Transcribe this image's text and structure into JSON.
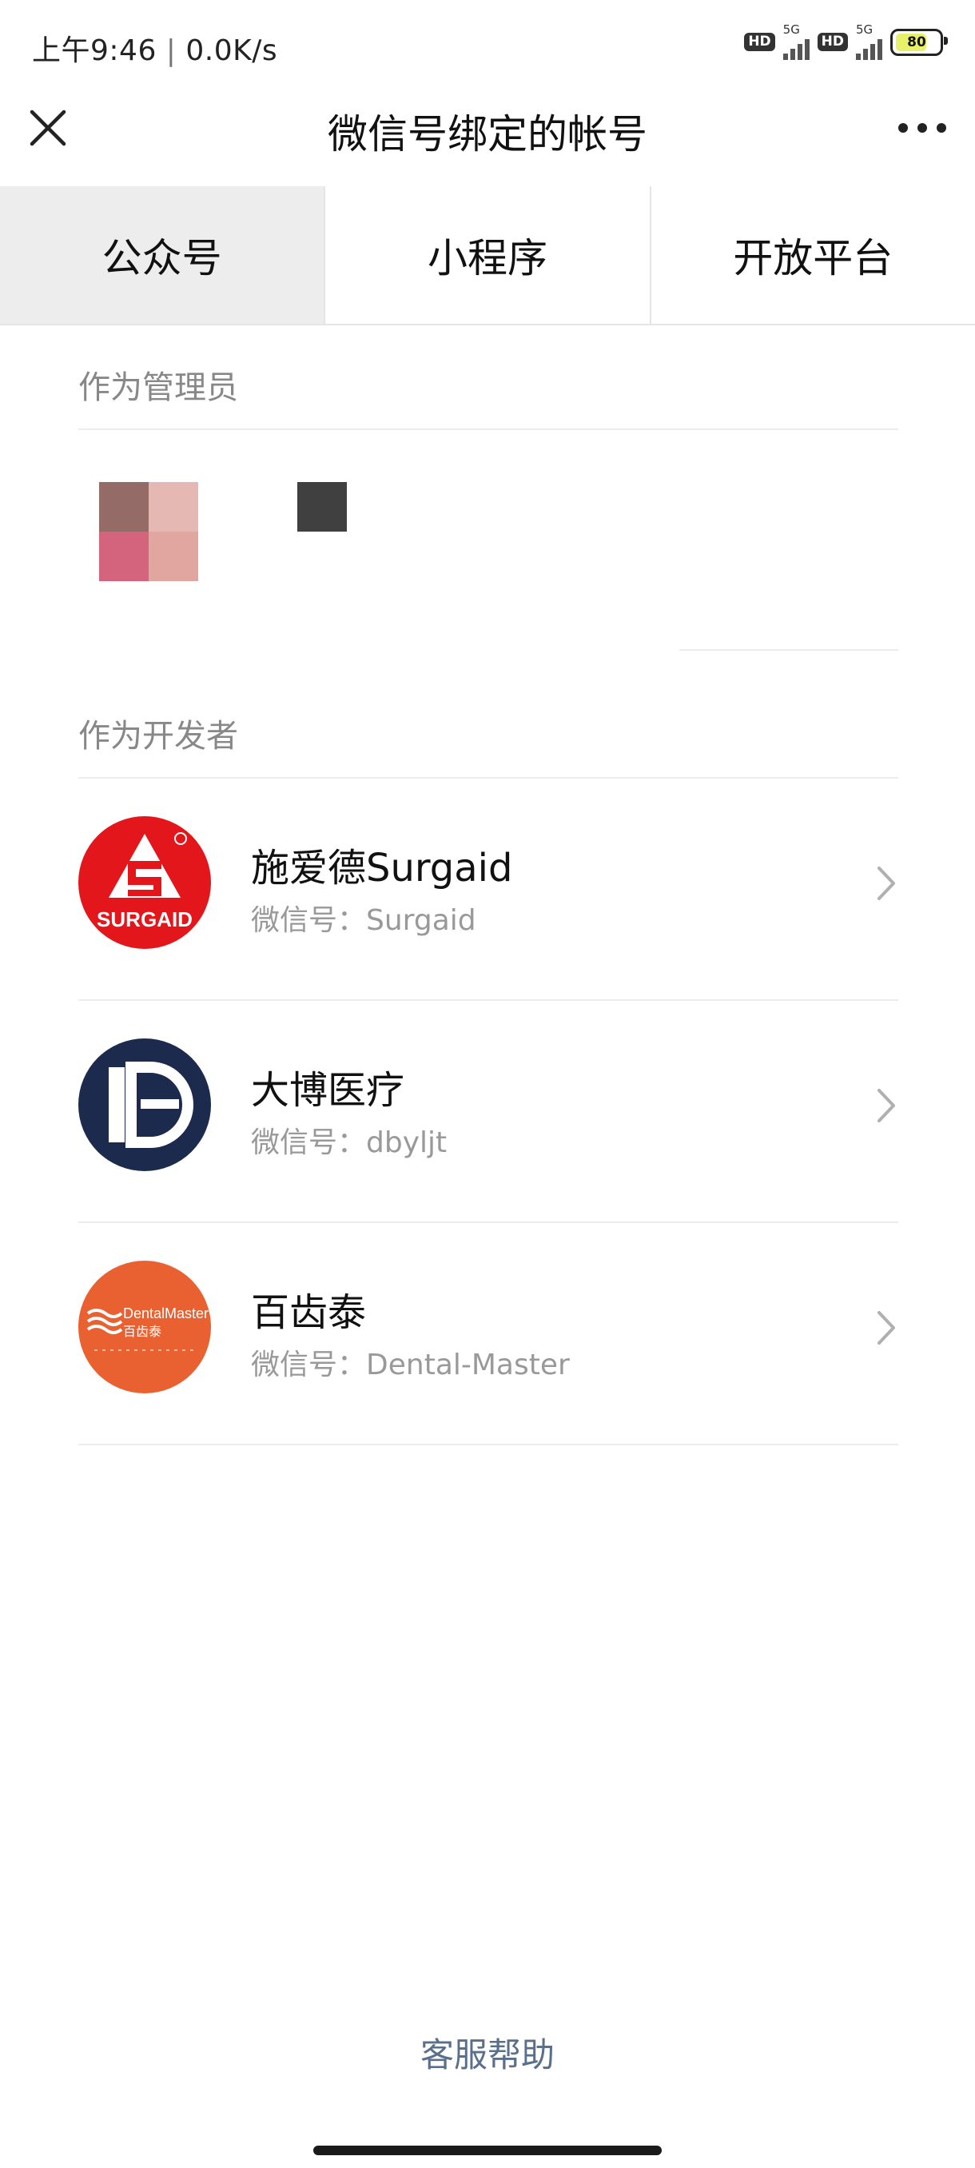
{
  "status_bar": {
    "time": "上午9:46",
    "speed": "0.0K/s",
    "hd_label": "HD",
    "network_label": "5G",
    "battery_level": "80"
  },
  "nav": {
    "title": "微信号绑定的帐号",
    "close_icon": "close-icon",
    "more_icon": "more-icon"
  },
  "tabs": [
    {
      "label": "公众号",
      "active": true
    },
    {
      "label": "小程序",
      "active": false
    },
    {
      "label": "开放平台",
      "active": false
    }
  ],
  "admin_section": {
    "title": "作为管理员"
  },
  "developer_section": {
    "title": "作为开发者",
    "items": [
      {
        "name": "施爱德Surgaid",
        "wechat_prefix": "微信号：",
        "wechat_id": "Surgaid",
        "logo_text": "SURGAID",
        "logo_color": "#e3161b"
      },
      {
        "name": "大博医疗",
        "wechat_prefix": "微信号：",
        "wechat_id": "dbyljt",
        "logo_text": "",
        "logo_color": "#1c2a4e"
      },
      {
        "name": "百齿泰",
        "wechat_prefix": "微信号：",
        "wechat_id": "Dental-Master",
        "logo_text": "DentalMaster",
        "logo_subtext": "百齿泰",
        "logo_color": "#ea6131"
      }
    ]
  },
  "footer": {
    "help_label": "客服帮助"
  },
  "colors": {
    "tab_active_bg": "#ededed",
    "section_title": "#888888",
    "help_link": "#5a6f8c"
  }
}
